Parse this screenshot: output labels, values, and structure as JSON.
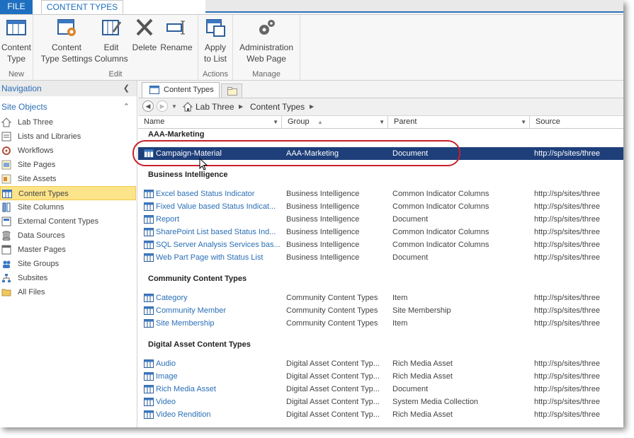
{
  "ribbon_tabs": {
    "file": "FILE",
    "content_types": "CONTENT TYPES"
  },
  "ribbon": {
    "new": {
      "label": "New",
      "content_type": [
        "Content",
        "Type"
      ]
    },
    "edit": {
      "label": "Edit",
      "content_type_settings": [
        "Content",
        "Type Settings"
      ],
      "edit_columns": [
        "Edit",
        "Columns"
      ],
      "delete": "Delete",
      "rename": "Rename"
    },
    "actions": {
      "label": "Actions",
      "apply": [
        "Apply",
        "to List"
      ]
    },
    "manage": {
      "label": "Manage",
      "admin": [
        "Administration",
        "Web Page"
      ]
    }
  },
  "nav": {
    "header": "Navigation",
    "section": "Site Objects",
    "items": [
      {
        "label": "Lab Three",
        "icon": "home-icon"
      },
      {
        "label": "Lists and Libraries",
        "icon": "list-icon"
      },
      {
        "label": "Workflows",
        "icon": "workflow-icon"
      },
      {
        "label": "Site Pages",
        "icon": "pages-icon"
      },
      {
        "label": "Site Assets",
        "icon": "assets-icon"
      },
      {
        "label": "Content Types",
        "icon": "content-type-icon"
      },
      {
        "label": "Site Columns",
        "icon": "columns-icon"
      },
      {
        "label": "External Content Types",
        "icon": "external-icon"
      },
      {
        "label": "Data Sources",
        "icon": "database-icon"
      },
      {
        "label": "Master Pages",
        "icon": "master-icon"
      },
      {
        "label": "Site Groups",
        "icon": "group-icon"
      },
      {
        "label": "Subsites",
        "icon": "subsites-icon"
      },
      {
        "label": "All Files",
        "icon": "folder-icon"
      }
    ],
    "selected_index": 5
  },
  "doc_tab": "Content Types",
  "breadcrumb": [
    "Lab Three",
    "Content Types"
  ],
  "columns": [
    "Name",
    "Group",
    "Parent",
    "Source"
  ],
  "groups": [
    {
      "name": "AAA-Marketing",
      "rows": [
        [
          "Campaign-Material",
          "AAA-Marketing",
          "Document",
          "http://sp/sites/three"
        ]
      ]
    },
    {
      "name": "Business Intelligence",
      "rows": [
        [
          "Excel based Status Indicator",
          "Business Intelligence",
          "Common Indicator Columns",
          "http://sp/sites/three"
        ],
        [
          "Fixed Value based Status Indicat...",
          "Business Intelligence",
          "Common Indicator Columns",
          "http://sp/sites/three"
        ],
        [
          "Report",
          "Business Intelligence",
          "Document",
          "http://sp/sites/three"
        ],
        [
          "SharePoint List based Status Ind...",
          "Business Intelligence",
          "Common Indicator Columns",
          "http://sp/sites/three"
        ],
        [
          "SQL Server Analysis Services bas...",
          "Business Intelligence",
          "Common Indicator Columns",
          "http://sp/sites/three"
        ],
        [
          "Web Part Page with Status List",
          "Business Intelligence",
          "Document",
          "http://sp/sites/three"
        ]
      ]
    },
    {
      "name": "Community Content Types",
      "rows": [
        [
          "Category",
          "Community Content Types",
          "Item",
          "http://sp/sites/three"
        ],
        [
          "Community Member",
          "Community Content Types",
          "Site Membership",
          "http://sp/sites/three"
        ],
        [
          "Site Membership",
          "Community Content Types",
          "Item",
          "http://sp/sites/three"
        ]
      ]
    },
    {
      "name": "Digital Asset Content Types",
      "rows": [
        [
          "Audio",
          "Digital Asset Content Typ...",
          "Rich Media Asset",
          "http://sp/sites/three"
        ],
        [
          "Image",
          "Digital Asset Content Typ...",
          "Rich Media Asset",
          "http://sp/sites/three"
        ],
        [
          "Rich Media Asset",
          "Digital Asset Content Typ...",
          "Document",
          "http://sp/sites/three"
        ],
        [
          "Video",
          "Digital Asset Content Typ...",
          "System Media Collection",
          "http://sp/sites/three"
        ],
        [
          "Video Rendition",
          "Digital Asset Content Typ...",
          "Rich Media Asset",
          "http://sp/sites/three"
        ]
      ]
    }
  ],
  "colors": {
    "accent": "#2a6fb7",
    "file_tab": "#1e6fbf",
    "selected_row": "#1e3f7a",
    "nav_selected": "#fce48a",
    "annotation": "#c8202a"
  }
}
